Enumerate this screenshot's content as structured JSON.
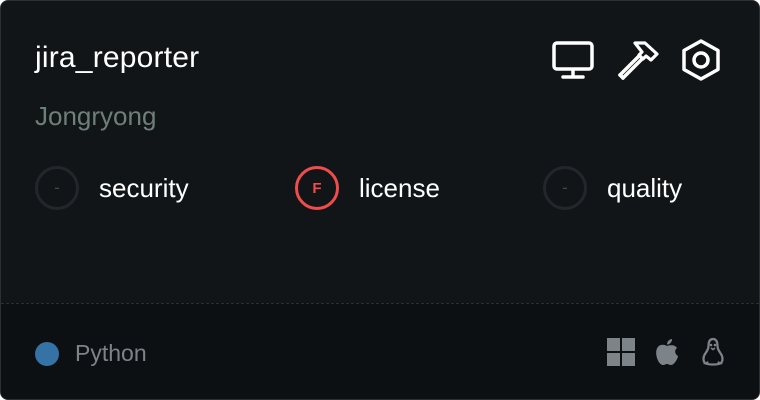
{
  "card": {
    "title": "jira_reporter",
    "author": "Jongryong",
    "header_icons": [
      "desktop-monitor-icon",
      "hammer-icon",
      "settings-hexagon-icon"
    ],
    "metrics": [
      {
        "grade": "-",
        "label": "security",
        "status": "none"
      },
      {
        "grade": "F",
        "label": "license",
        "status": "fail"
      },
      {
        "grade": "-",
        "label": "quality",
        "status": "none"
      }
    ],
    "language": {
      "name": "Python",
      "color": "#3572a5"
    },
    "platforms": [
      "windows-icon",
      "apple-icon",
      "linux-icon"
    ]
  },
  "colors": {
    "background": "#111518",
    "footer": "#0d1013",
    "fail": "#f14c4c",
    "author": "#6e7f78",
    "muted": "#7d8489"
  }
}
